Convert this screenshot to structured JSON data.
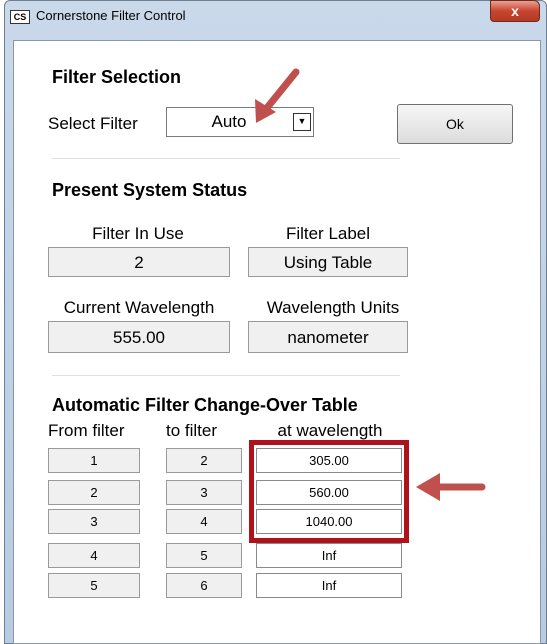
{
  "window": {
    "title": "Cornerstone  Filter Control",
    "icon_text": "CS",
    "close_symbol": "x"
  },
  "filter_selection": {
    "heading": "Filter Selection",
    "select_label": "Select Filter",
    "selected_value": "Auto",
    "ok_label": "Ok"
  },
  "status": {
    "heading": "Present System Status",
    "filter_in_use_label": "Filter In Use",
    "filter_in_use_value": "2",
    "filter_label_label": "Filter Label",
    "filter_label_value": "Using Table",
    "current_wavelength_label": "Current Wavelength",
    "current_wavelength_value": "555.00",
    "wavelength_units_label": "Wavelength Units",
    "wavelength_units_value": "nanometer"
  },
  "table": {
    "heading": "Automatic Filter Change-Over Table",
    "columns": [
      "From filter",
      "to filter",
      "at wavelength"
    ],
    "rows": [
      {
        "from": "1",
        "to": "2",
        "wavelength": "305.00"
      },
      {
        "from": "2",
        "to": "3",
        "wavelength": "560.00"
      },
      {
        "from": "3",
        "to": "4",
        "wavelength": "1040.00"
      },
      {
        "from": "4",
        "to": "5",
        "wavelength": "Inf"
      },
      {
        "from": "5",
        "to": "6",
        "wavelength": "Inf"
      }
    ]
  },
  "annotations": {
    "color": "#c0504d",
    "highlight_color": "#b0121c"
  }
}
